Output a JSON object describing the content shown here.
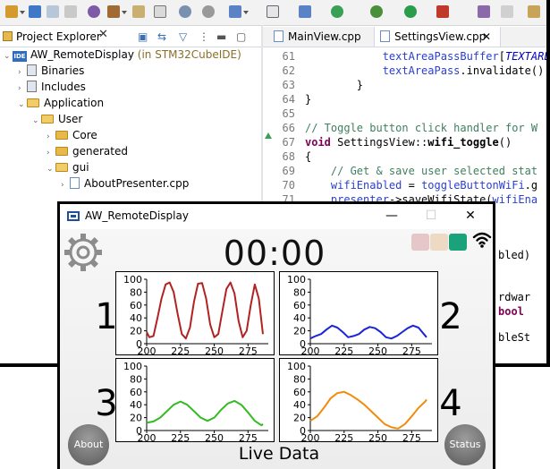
{
  "ide": {
    "project_explorer": {
      "tab_label": "Project Explorer",
      "tree": [
        {
          "label": "AW_RemoteDisplay",
          "suffix": " (in STM32CubeIDE)",
          "type": "project",
          "depth": 0,
          "expanded": true
        },
        {
          "label": "Binaries",
          "type": "binaries",
          "depth": 1,
          "expanded": false
        },
        {
          "label": "Includes",
          "type": "includes",
          "depth": 1,
          "expanded": false
        },
        {
          "label": "Application",
          "type": "folder",
          "depth": 1,
          "expanded": true
        },
        {
          "label": "User",
          "type": "folder",
          "depth": 2,
          "expanded": true
        },
        {
          "label": "Core",
          "type": "folder",
          "depth": 3,
          "expanded": false
        },
        {
          "label": "generated",
          "type": "folder",
          "depth": 3,
          "expanded": false
        },
        {
          "label": "gui",
          "type": "folder",
          "depth": 3,
          "expanded": true
        },
        {
          "label": "AboutPresenter.cpp",
          "type": "file",
          "depth": 4,
          "expanded": false
        }
      ]
    },
    "editor": {
      "tabs": [
        {
          "label": "MainView.cpp",
          "active": false
        },
        {
          "label": "SettingsView.cpp",
          "active": true
        }
      ],
      "lines": [
        {
          "n": "61",
          "parts": [
            [
              "            ",
              ""
            ],
            [
              "textAreaPassBuffer",
              "blue"
            ],
            [
              "[",
              ""
            ],
            [
              "TEXTAREAP",
              "it"
            ]
          ]
        },
        {
          "n": "62",
          "parts": [
            [
              "            ",
              ""
            ],
            [
              "textAreaPass",
              "blue"
            ],
            [
              ".invalidate();",
              ""
            ]
          ]
        },
        {
          "n": "63",
          "parts": [
            [
              "        }",
              ""
            ]
          ]
        },
        {
          "n": "64",
          "parts": [
            [
              "}",
              ""
            ]
          ]
        },
        {
          "n": "65",
          "parts": [
            [
              "",
              ""
            ]
          ]
        },
        {
          "n": "66",
          "parts": [
            [
              "// Toggle button click handler for W",
              "cm"
            ]
          ]
        },
        {
          "n": "67",
          "parts": [
            [
              "void",
              "kw"
            ],
            [
              " SettingsView::",
              ""
            ],
            [
              "wifi_toggle",
              "b"
            ],
            [
              "()",
              ""
            ]
          ]
        },
        {
          "n": "68",
          "parts": [
            [
              "{",
              ""
            ]
          ]
        },
        {
          "n": "69",
          "parts": [
            [
              "    // Get & save user selected stat",
              "cm"
            ]
          ]
        },
        {
          "n": "70",
          "parts": [
            [
              "    ",
              ""
            ],
            [
              "wifiEnabled",
              "blue"
            ],
            [
              " = ",
              ""
            ],
            [
              "toggleButtonWiFi",
              "blue"
            ],
            [
              ".g",
              ""
            ]
          ]
        },
        {
          "n": "71",
          "parts": [
            [
              "    ",
              ""
            ],
            [
              "presenter",
              "blue"
            ],
            [
              "->saveWifiState(",
              ""
            ],
            [
              "wifiEna",
              "blue"
            ]
          ]
        }
      ],
      "fragments": [
        "bled)",
        "rdwar",
        "bool",
        "bleSt"
      ]
    }
  },
  "simulator": {
    "title": "AW_RemoteDisplay",
    "timer": "00:00",
    "live_label": "Live Data",
    "about_label": "About",
    "status_label": "Status",
    "swatches": [
      "#e6c7c9",
      "#eed9c4",
      "#1aa37a"
    ],
    "chart_numbers": [
      "1",
      "2",
      "3",
      "4"
    ]
  },
  "chart_data": [
    {
      "type": "line",
      "title": "",
      "xlabel": "",
      "ylabel": "",
      "color": "#b22222",
      "x": [
        200,
        202,
        205,
        208,
        211,
        214,
        217,
        220,
        223,
        226,
        229,
        232,
        235,
        238,
        241,
        244,
        247,
        250,
        253,
        256,
        259,
        262,
        265,
        268,
        271,
        274,
        277,
        280,
        283,
        286
      ],
      "y": [
        18,
        10,
        12,
        40,
        70,
        92,
        95,
        80,
        45,
        15,
        8,
        25,
        65,
        93,
        94,
        70,
        30,
        10,
        15,
        50,
        85,
        95,
        78,
        35,
        10,
        20,
        60,
        92,
        70,
        15
      ],
      "xlim": [
        200,
        290
      ],
      "ylim": [
        0,
        100
      ],
      "xticks": [
        200,
        225,
        250,
        275
      ],
      "yticks": [
        0,
        20,
        40,
        60,
        80,
        100
      ]
    },
    {
      "type": "line",
      "title": "",
      "xlabel": "",
      "ylabel": "",
      "color": "#1a25d8",
      "x": [
        200,
        204,
        208,
        212,
        216,
        220,
        224,
        228,
        232,
        236,
        240,
        244,
        248,
        252,
        256,
        260,
        264,
        268,
        272,
        276,
        280,
        284,
        286
      ],
      "y": [
        8,
        12,
        15,
        22,
        28,
        25,
        18,
        10,
        12,
        15,
        22,
        26,
        24,
        18,
        10,
        8,
        12,
        18,
        24,
        28,
        25,
        15,
        10
      ],
      "xlim": [
        200,
        290
      ],
      "ylim": [
        0,
        100
      ],
      "xticks": [
        200,
        225,
        250,
        275
      ],
      "yticks": [
        0,
        20,
        40,
        60,
        80,
        100
      ]
    },
    {
      "type": "line",
      "title": "",
      "xlabel": "",
      "ylabel": "",
      "color": "#33bb22",
      "x": [
        200,
        205,
        210,
        215,
        220,
        225,
        230,
        235,
        240,
        245,
        250,
        255,
        260,
        265,
        270,
        275,
        280,
        285,
        286
      ],
      "y": [
        12,
        14,
        20,
        30,
        40,
        45,
        40,
        30,
        20,
        15,
        20,
        32,
        42,
        46,
        40,
        28,
        15,
        8,
        10
      ],
      "xlim": [
        200,
        290
      ],
      "ylim": [
        0,
        100
      ],
      "xticks": [
        200,
        225,
        250,
        275
      ],
      "yticks": [
        0,
        20,
        40,
        60,
        80,
        100
      ]
    },
    {
      "type": "line",
      "title": "",
      "xlabel": "",
      "ylabel": "",
      "color": "#f08c0a",
      "x": [
        200,
        205,
        210,
        215,
        220,
        225,
        230,
        235,
        240,
        245,
        250,
        255,
        260,
        265,
        270,
        275,
        280,
        285,
        286
      ],
      "y": [
        15,
        22,
        35,
        50,
        58,
        60,
        55,
        48,
        40,
        30,
        20,
        10,
        5,
        3,
        10,
        22,
        35,
        45,
        48
      ],
      "xlim": [
        200,
        290
      ],
      "ylim": [
        0,
        100
      ],
      "xticks": [
        200,
        225,
        250,
        275
      ],
      "yticks": [
        0,
        20,
        40,
        60,
        80,
        100
      ]
    }
  ]
}
